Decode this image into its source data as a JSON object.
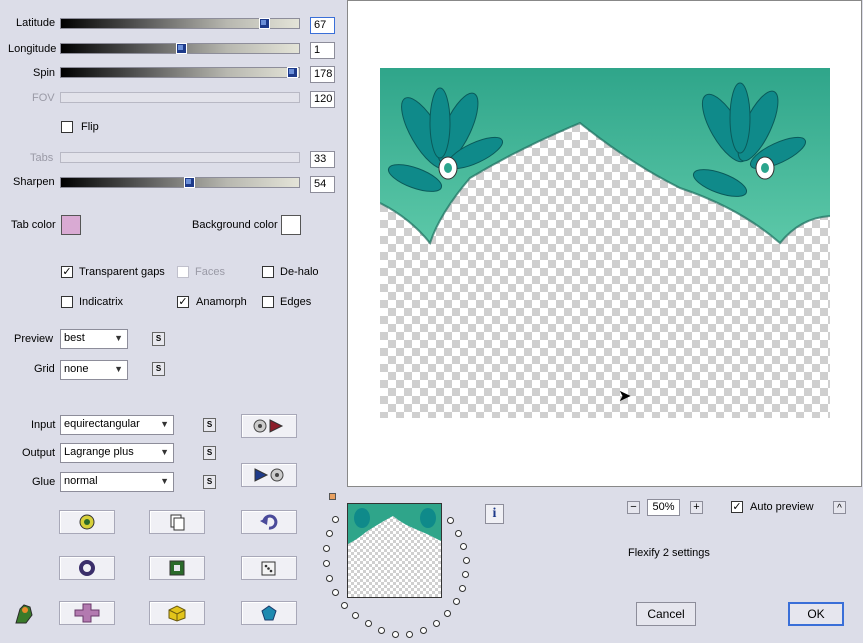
{
  "sliders": {
    "latitude": {
      "label": "Latitude",
      "value": "67",
      "fraction": 0.85
    },
    "longitude": {
      "label": "Longitude",
      "value": "1",
      "fraction": 0.5
    },
    "spin": {
      "label": "Spin",
      "value": "178",
      "fraction": 0.98
    },
    "fov": {
      "label": "FOV",
      "value": "120"
    },
    "tabs": {
      "label": "Tabs",
      "value": "33"
    },
    "sharpen": {
      "label": "Sharpen",
      "value": "54",
      "fraction": 0.54
    }
  },
  "flip_label": "Flip",
  "tab_color": {
    "label": "Tab color",
    "color": "#d9aad3"
  },
  "background_color": {
    "label": "Background color",
    "color": "#ffffff"
  },
  "options": {
    "transparent_gaps": "Transparent gaps",
    "faces": "Faces",
    "de_halo": "De-halo",
    "indicatrix": "Indicatrix",
    "anamorph": "Anamorph",
    "edges": "Edges"
  },
  "preview": {
    "label": "Preview",
    "value": "best"
  },
  "grid": {
    "label": "Grid",
    "value": "none"
  },
  "input": {
    "label": "Input",
    "value": "equirectangular"
  },
  "output": {
    "label": "Output",
    "value": "Lagrange plus"
  },
  "glue": {
    "label": "Glue",
    "value": "normal"
  },
  "s_label": "S",
  "zoom": {
    "value": "50%",
    "minus": "−",
    "plus": "+"
  },
  "auto_preview_label": "Auto preview",
  "settings_title": "Flexify 2 settings",
  "cancel_label": "Cancel",
  "ok_label": "OK",
  "info_label": "i",
  "caret_label": "^",
  "colors": {
    "teal": "#2aa58d",
    "dark_teal": "#0e6a66",
    "accent": "#3a6fd8"
  }
}
